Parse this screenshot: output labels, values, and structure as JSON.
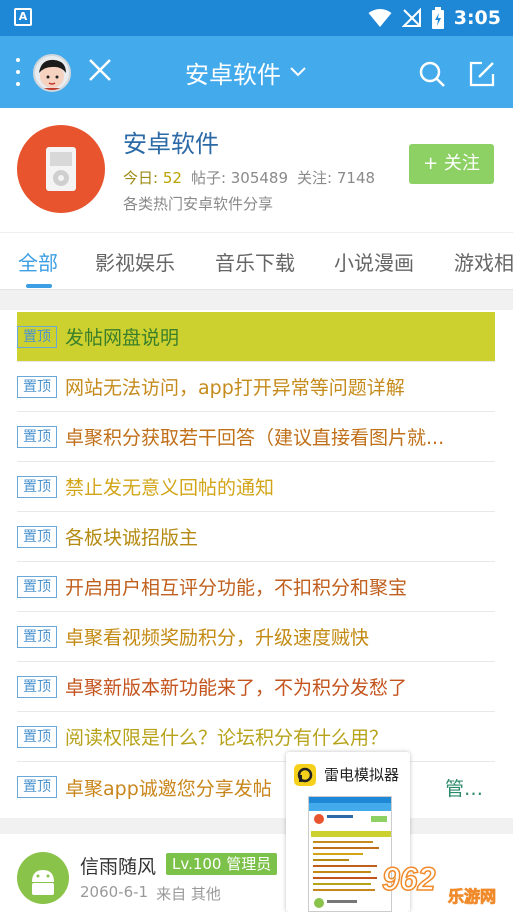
{
  "status": {
    "time": "3:05",
    "left_icon_letter": "A"
  },
  "appbar": {
    "title": "安卓软件"
  },
  "forum": {
    "name": "安卓软件",
    "today_label": "今日:",
    "today_value": "52",
    "posts": "帖子: 305489",
    "followers": "关注: 7148",
    "description": "各类热门安卓软件分享",
    "follow_label": "+ 关注"
  },
  "tabs": [
    {
      "label": "全部"
    },
    {
      "label": "影视娱乐"
    },
    {
      "label": "音乐下载"
    },
    {
      "label": "小说漫画"
    },
    {
      "label": "游戏相"
    }
  ],
  "pin_label": "置顶",
  "threads": [
    {
      "title": "发帖网盘说明",
      "color": "#3a7f2a",
      "highlight": true
    },
    {
      "title": "网站无法访问，app打开异常等问题详解",
      "color": "#c58b1c"
    },
    {
      "title": "卓聚积分获取若干回答（建议直接看图片就...",
      "color": "#c0701a"
    },
    {
      "title": "禁止发无意义回帖的通知",
      "color": "#d2a519"
    },
    {
      "title": "各板块诚招版主",
      "color": "#b48a12"
    },
    {
      "title": "开启用户相互评分功能，不扣积分和聚宝",
      "color": "#c0601f"
    },
    {
      "title": "卓聚看视频奖励积分，升级速度贼快",
      "color": "#c38a13"
    },
    {
      "title": "卓聚新版本新功能来了，不为积分发愁了",
      "color": "#c4541d"
    },
    {
      "title": "阅读权限是什么？论坛积分有什么用？",
      "color": "#b7a31a"
    },
    {
      "title": "卓聚app诚邀您分享发帖",
      "suffix": "管理...",
      "color": "#c9861c"
    }
  ],
  "post": {
    "author": "信雨随风",
    "badge": "Lv.100 管理员",
    "date": "2060-6-1",
    "source": "来自 其他"
  },
  "popup": {
    "title": "雷电模拟器"
  },
  "watermark": {
    "text": "962",
    "sub": "乐游网"
  },
  "colors": {
    "appbar": "#43aaec",
    "statusbar": "#1e88d6",
    "accent": "#3c9ee5",
    "follow": "#8dd165",
    "highlight": "#cdd12f"
  }
}
